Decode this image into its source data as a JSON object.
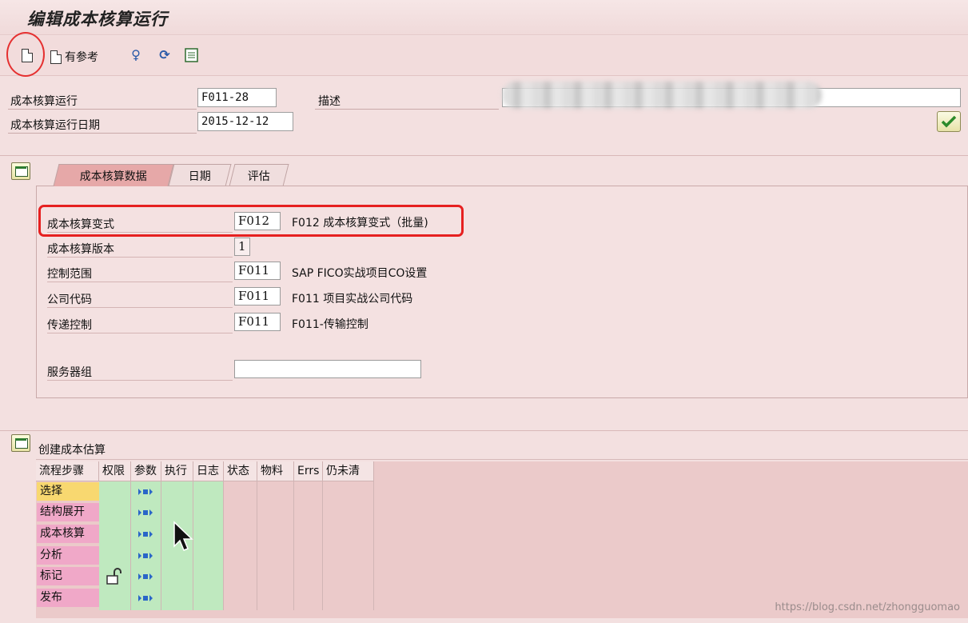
{
  "window": {
    "title": "编辑成本核算运行"
  },
  "toolbar": {
    "with_reference_label": "有参考"
  },
  "header": {
    "run_label": "成本核算运行",
    "run_value": "F011-28",
    "date_label": "成本核算运行日期",
    "date_value": "2015-12-12",
    "desc_label": "描述",
    "desc_value": ""
  },
  "tabs": [
    {
      "label": "成本核算数据",
      "active": true
    },
    {
      "label": "日期",
      "active": false
    },
    {
      "label": "评估",
      "active": false
    }
  ],
  "costing_data": {
    "variant": {
      "label": "成本核算变式",
      "value": "F012",
      "desc": "F012 成本核算变式（批量)"
    },
    "version": {
      "label": "成本核算版本",
      "value": "1"
    },
    "controlling_area": {
      "label": "控制范围",
      "value": "F011",
      "desc": "SAP FICO实战项目CO设置"
    },
    "company_code": {
      "label": "公司代码",
      "value": "F011",
      "desc": "F011 项目实战公司代码"
    },
    "transfer_control": {
      "label": "传递控制",
      "value": "F011",
      "desc": "F011-传输控制"
    },
    "server_group": {
      "label": "服务器组",
      "value": ""
    }
  },
  "create_section": {
    "title": "创建成本估算"
  },
  "grid": {
    "columns": [
      "流程步骤",
      "权限",
      "参数",
      "执行",
      "日志",
      "状态",
      "物料",
      "Errs",
      "仍未清"
    ],
    "steps": [
      "选择",
      "结构展开",
      "成本核算",
      "分析",
      "标记",
      "发布"
    ]
  },
  "watermark": "https://blog.csdn.net/zhongguomao",
  "colors": {
    "accent_red": "#e62020",
    "selected_step": "#f8d870",
    "step_bg": "#f0a8c8",
    "exec_green": "#bfe9bf"
  }
}
